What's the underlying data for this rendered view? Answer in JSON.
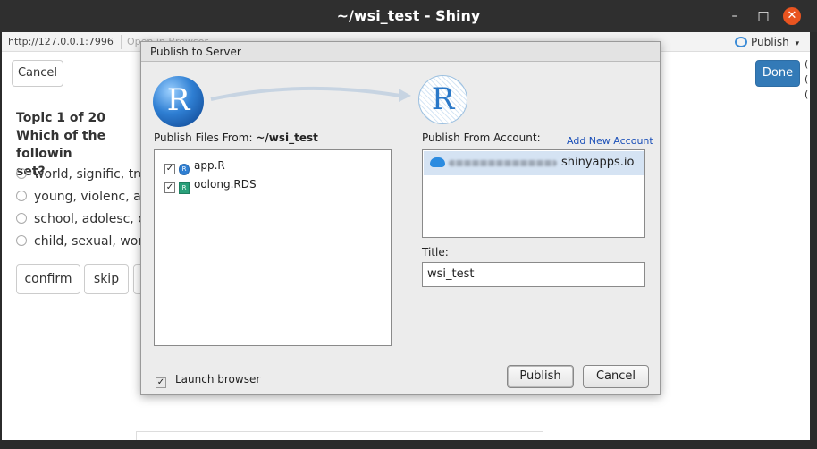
{
  "window": {
    "title": "~/wsi_test - Shiny",
    "minimize": "–",
    "maximize": "□",
    "close": "✕"
  },
  "toolbar": {
    "url": "http://127.0.0.1:7996",
    "open_in_browser": "Open in Browser",
    "publish_label": "Publish",
    "publish_caret": "▾"
  },
  "app": {
    "cancel_label": "Cancel",
    "done_label": "Done",
    "topic_heading": "Topic 1 of 20",
    "question_line1": "Which of the followin",
    "question_line2": "set?",
    "choices": [
      "world, signific, treat",
      "young, violenc, adu",
      "school, adolesc, ch",
      "child, sexual, wome"
    ],
    "confirm_label": "confirm",
    "skip_label": "skip",
    "right_edge_glyphs": [
      "(",
      "(",
      "("
    ]
  },
  "dialog": {
    "title": "Publish to Server",
    "source_logo": "R",
    "dest_logo": "R",
    "files_label_prefix": "Publish Files From: ",
    "files_path": "~/wsi_test",
    "files": [
      {
        "name": "app.R",
        "checked": true,
        "icon": "r-file-icon"
      },
      {
        "name": "oolong.RDS",
        "checked": true,
        "icon": "rds-file-icon"
      }
    ],
    "account_label": "Publish From Account:",
    "add_account_link": "Add New Account",
    "account_server": "shinyapps.io",
    "title_label": "Title:",
    "title_value": "wsi_test",
    "launch_browser_label": "Launch browser",
    "launch_browser_checked": true,
    "publish_button": "Publish",
    "cancel_button": "Cancel"
  }
}
